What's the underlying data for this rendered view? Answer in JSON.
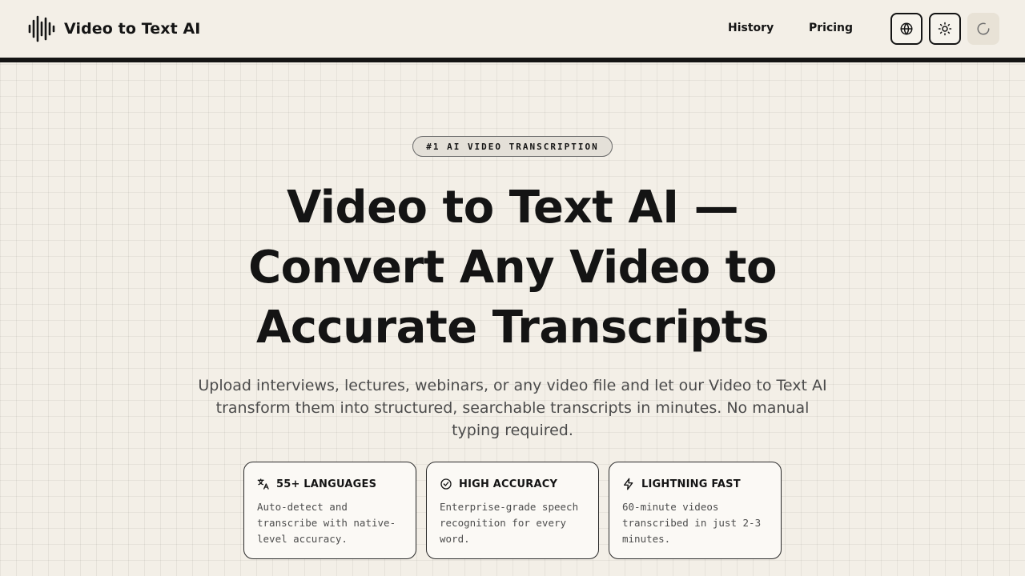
{
  "header": {
    "brand_name": "Video to Text AI",
    "nav": [
      {
        "label": "History"
      },
      {
        "label": "Pricing"
      }
    ],
    "buttons": {
      "language": "globe-icon",
      "theme": "sun-icon",
      "account": "loading-spinner-icon"
    }
  },
  "hero": {
    "badge": "#1 AI VIDEO TRANSCRIPTION",
    "title_lines": [
      "Video to Text AI —",
      "Convert Any Video to",
      "Accurate Transcripts"
    ],
    "subtitle": "Upload interviews, lectures, webinars, or any video file and let our Video to Text AI transform them into structured, searchable transcripts in minutes. No manual typing required."
  },
  "features": [
    {
      "icon": "translate-icon",
      "title": "55+ LANGUAGES",
      "text": "Auto-detect and transcribe with native-level accuracy."
    },
    {
      "icon": "check-badge-icon",
      "title": "HIGH ACCURACY",
      "text": "Enterprise-grade speech recognition for every word."
    },
    {
      "icon": "lightning-icon",
      "title": "LIGHTNING FAST",
      "text": "60-minute videos transcribed in just 2-3 minutes."
    }
  ],
  "colors": {
    "background": "#f3efe7",
    "text": "#141414",
    "muted_text": "#4b4b4b",
    "header_rule": "#141414"
  }
}
